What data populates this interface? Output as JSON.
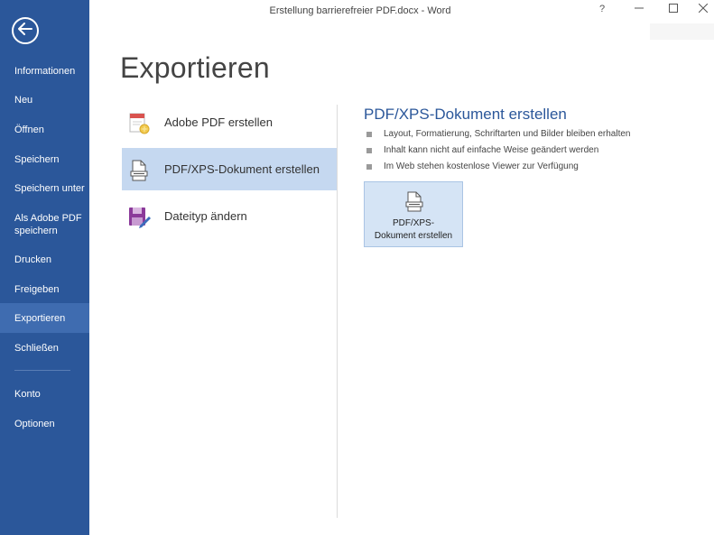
{
  "window": {
    "title": "Erstellung barrierefreier PDF.docx - Word",
    "help_glyph": "?",
    "minimize_glyph": "—",
    "close_glyph": "✕"
  },
  "sidebar": {
    "back_icon": "back-arrow-icon",
    "items": [
      {
        "label": "Informationen"
      },
      {
        "label": "Neu"
      },
      {
        "label": "Öffnen"
      },
      {
        "label": "Speichern"
      },
      {
        "label": "Speichern unter"
      },
      {
        "label": "Als Adobe PDF speichern"
      },
      {
        "label": "Drucken"
      },
      {
        "label": "Freigeben"
      },
      {
        "label": "Exportieren",
        "active": true
      },
      {
        "label": "Schließen"
      },
      {
        "label": "Konto"
      },
      {
        "label": "Optionen"
      }
    ]
  },
  "main": {
    "title": "Exportieren",
    "options": [
      {
        "label": "Adobe PDF erstellen",
        "icon": "adobe-pdf-icon"
      },
      {
        "label": "PDF/XPS-Dokument erstellen",
        "icon": "pdf-xps-document-icon",
        "selected": true
      },
      {
        "label": "Dateityp ändern",
        "icon": "change-filetype-icon"
      }
    ],
    "detail": {
      "title": "PDF/XPS-Dokument erstellen",
      "bullets": [
        "Layout, Formatierung, Schriftarten und Bilder bleiben erhalten",
        "Inhalt kann nicht auf einfache Weise geändert werden",
        "Im Web stehen kostenlose Viewer zur Verfügung"
      ],
      "button_label": "PDF/XPS-\nDokument erstellen",
      "button_icon": "pdf-xps-document-icon"
    }
  },
  "colors": {
    "sidebar": "#2b579a",
    "sidebar_active": "#3f6cb0",
    "accent_text": "#2b579a",
    "selected_option": "#c5d8f0",
    "button_bg": "#d5e4f5"
  }
}
